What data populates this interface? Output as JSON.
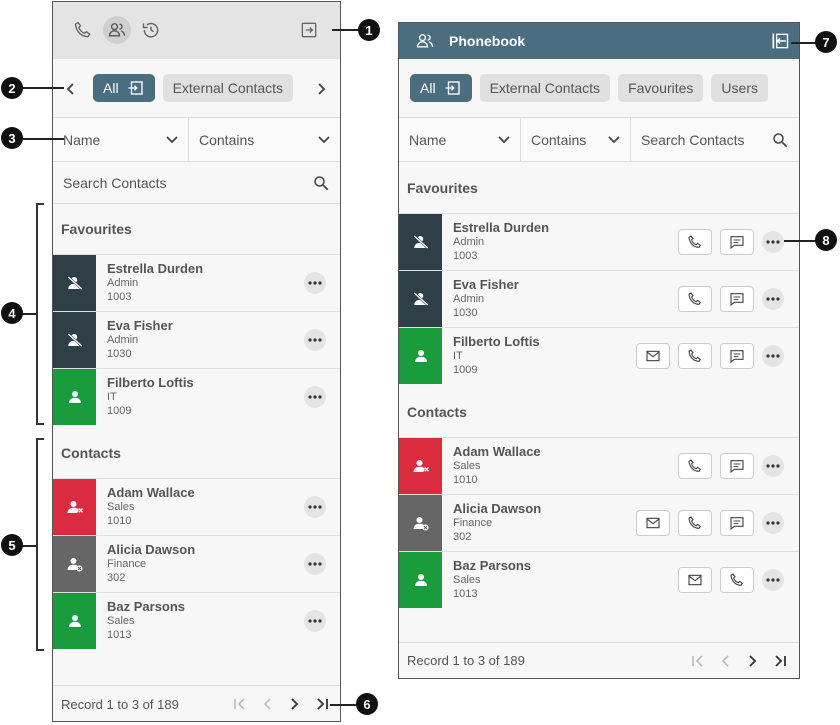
{
  "left": {
    "chips": [
      "All",
      "External Contacts"
    ],
    "filter": {
      "field": "Name",
      "operator": "Contains"
    },
    "search_placeholder": "Search Contacts",
    "favourites_label": "Favourites",
    "contacts_label": "Contacts",
    "favourites": [
      {
        "name": "Estrella Durden",
        "dept": "Admin",
        "ext": "1003"
      },
      {
        "name": "Eva Fisher",
        "dept": "Admin",
        "ext": "1030"
      },
      {
        "name": "Filberto Loftis",
        "dept": "IT",
        "ext": "1009"
      }
    ],
    "contacts": [
      {
        "name": "Adam Wallace",
        "dept": "Sales",
        "ext": "1010"
      },
      {
        "name": "Alicia Dawson",
        "dept": "Finance",
        "ext": "302"
      },
      {
        "name": "Baz Parsons",
        "dept": "Sales",
        "ext": "1013"
      }
    ],
    "footer": "Record 1 to 3 of 189"
  },
  "right": {
    "title": "Phonebook",
    "chips": [
      "All",
      "External Contacts",
      "Favourites",
      "Users"
    ],
    "filter": {
      "field": "Name",
      "operator": "Contains",
      "search": "Search Contacts"
    },
    "favourites_label": "Favourites",
    "contacts_label": "Contacts",
    "favourites": [
      {
        "name": "Estrella Durden",
        "dept": "Admin",
        "ext": "1003"
      },
      {
        "name": "Eva Fisher",
        "dept": "Admin",
        "ext": "1030"
      },
      {
        "name": "Filberto Loftis",
        "dept": "IT",
        "ext": "1009"
      }
    ],
    "contacts": [
      {
        "name": "Adam Wallace",
        "dept": "Sales",
        "ext": "1010"
      },
      {
        "name": "Alicia Dawson",
        "dept": "Finance",
        "ext": "302"
      },
      {
        "name": "Baz Parsons",
        "dept": "Sales",
        "ext": "1013"
      }
    ],
    "footer": "Record 1 to 3 of 189"
  },
  "callouts": [
    "1",
    "2",
    "3",
    "4",
    "5",
    "6",
    "7",
    "8"
  ],
  "colors": {
    "accent": "#4a6e80",
    "dnd": "#2f3f48",
    "available": "#1a9c3c",
    "busy": "#d92d3f",
    "offline": "#666666"
  }
}
